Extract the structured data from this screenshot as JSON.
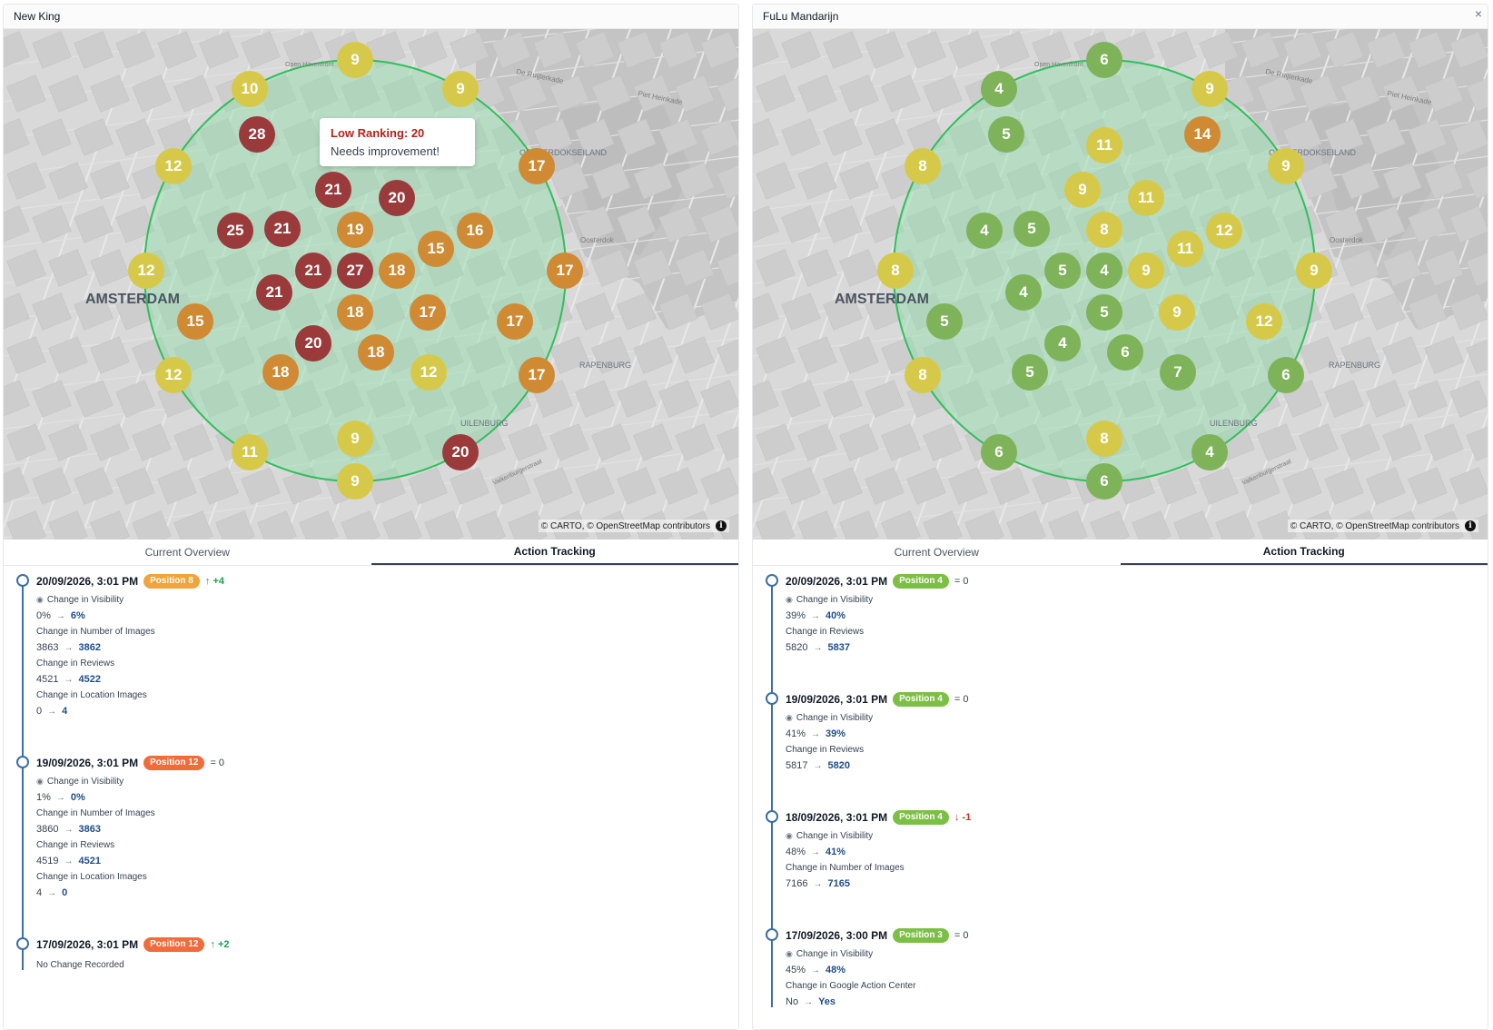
{
  "panels": [
    {
      "title": "New King",
      "close": "",
      "attribution": "© CARTO, © OpenStreetMap contributors",
      "tooltip": {
        "title": "Low Ranking: 20",
        "message": "Needs improvement!"
      },
      "map_labels": [
        "AMSTERDAM",
        "OOSTERDOKSEILAND",
        "RAPENBURG",
        "UILENBURG",
        "Oosterdok",
        "De Ruijterkade",
        "Piet Heinkade",
        "Open Havenfront",
        "Valkenburgerstraat"
      ],
      "markers": [
        "9",
        "10",
        "9",
        "28",
        "12",
        "17",
        "21",
        "20",
        "25",
        "21",
        "19",
        "16",
        "15",
        "12",
        "21",
        "27",
        "18",
        "17",
        "21",
        "15",
        "18",
        "17",
        "17",
        "20",
        "18",
        "12",
        "18",
        "12",
        "17",
        "11",
        "9",
        "20",
        "9"
      ],
      "tabs": [
        "Current Overview",
        "Action Tracking"
      ],
      "active_tab": "Action Tracking",
      "entries": [
        {
          "date": "20/09/2026, 3:01 PM",
          "badge": "Position 8",
          "delta": "+4",
          "delta_type": "up",
          "changes": [
            {
              "label": "Change in Visibility",
              "from": "0%",
              "to": "6%"
            },
            {
              "label": "Change in Number of Images",
              "from": "3863",
              "to": "3862"
            },
            {
              "label": "Change in Reviews",
              "from": "4521",
              "to": "4522"
            },
            {
              "label": "Change in Location Images",
              "from": "0",
              "to": "4"
            }
          ]
        },
        {
          "date": "19/09/2026, 3:01 PM",
          "badge": "Position 12",
          "delta": "= 0",
          "delta_type": "eq",
          "changes": [
            {
              "label": "Change in Visibility",
              "from": "1%",
              "to": "0%"
            },
            {
              "label": "Change in Number of Images",
              "from": "3860",
              "to": "3863"
            },
            {
              "label": "Change in Reviews",
              "from": "4519",
              "to": "4521"
            },
            {
              "label": "Change in Location Images",
              "from": "4",
              "to": "0"
            }
          ]
        },
        {
          "date": "17/09/2026, 3:01 PM",
          "badge": "Position 12",
          "delta": "+2",
          "delta_type": "up",
          "no_change": "No Change Recorded"
        }
      ]
    },
    {
      "title": "FuLu Mandarijn",
      "close": "×",
      "attribution": "© CARTO, © OpenStreetMap contributors",
      "map_labels": [
        "AMSTERDAM",
        "OOSTERDOKSEILAND",
        "RAPENBURG",
        "UILENBURG",
        "Oosterdok",
        "De Ruijterkade",
        "Piet Heinkade",
        "Open Havenfront",
        "Valkenburgerstraat"
      ],
      "markers": [
        "6",
        "4",
        "9",
        "5",
        "14",
        "11",
        "8",
        "9",
        "9",
        "11",
        "4",
        "5",
        "8",
        "12",
        "11",
        "8",
        "5",
        "4",
        "9",
        "9",
        "4",
        "5",
        "9",
        "5",
        "12",
        "4",
        "6",
        "5",
        "7",
        "8",
        "6",
        "8",
        "6",
        "4",
        "6"
      ],
      "tabs": [
        "Current Overview",
        "Action Tracking"
      ],
      "active_tab": "Action Tracking",
      "entries": [
        {
          "date": "20/09/2026, 3:01 PM",
          "badge": "Position 4",
          "delta": "= 0",
          "delta_type": "eq",
          "changes": [
            {
              "label": "Change in Visibility",
              "from": "39%",
              "to": "40%"
            },
            {
              "label": "Change in Reviews",
              "from": "5820",
              "to": "5837"
            }
          ]
        },
        {
          "date": "19/09/2026, 3:01 PM",
          "badge": "Position 4",
          "delta": "= 0",
          "delta_type": "eq",
          "changes": [
            {
              "label": "Change in Visibility",
              "from": "41%",
              "to": "39%"
            },
            {
              "label": "Change in Reviews",
              "from": "5817",
              "to": "5820"
            }
          ]
        },
        {
          "date": "18/09/2026, 3:01 PM",
          "badge": "Position 4",
          "delta": "-1",
          "delta_type": "down",
          "changes": [
            {
              "label": "Change in Visibility",
              "from": "48%",
              "to": "41%"
            },
            {
              "label": "Change in Number of Images",
              "from": "7166",
              "to": "7165"
            }
          ]
        },
        {
          "date": "17/09/2026, 3:00 PM",
          "badge": "Position 3",
          "delta": "= 0",
          "delta_type": "eq",
          "changes": [
            {
              "label": "Change in Visibility",
              "from": "45%",
              "to": "48%"
            },
            {
              "label": "Change in Google Action Center",
              "from": "No",
              "to": "Yes"
            }
          ]
        }
      ]
    }
  ],
  "colors": {
    "rank_good": "#7fb35a",
    "rank_mid": "#d6c94a",
    "rank_poor": "#cf8a33",
    "rank_bad": "#9b3a3a",
    "badge_orange": "#f0a43a",
    "badge_red": "#f26b3a",
    "badge_green": "#7cbf45",
    "circle_stroke": "#2fbf5a",
    "circle_fill": "#8fe0a8",
    "timeline": "#3b6ea5",
    "new_value": "#1e4e8c"
  }
}
